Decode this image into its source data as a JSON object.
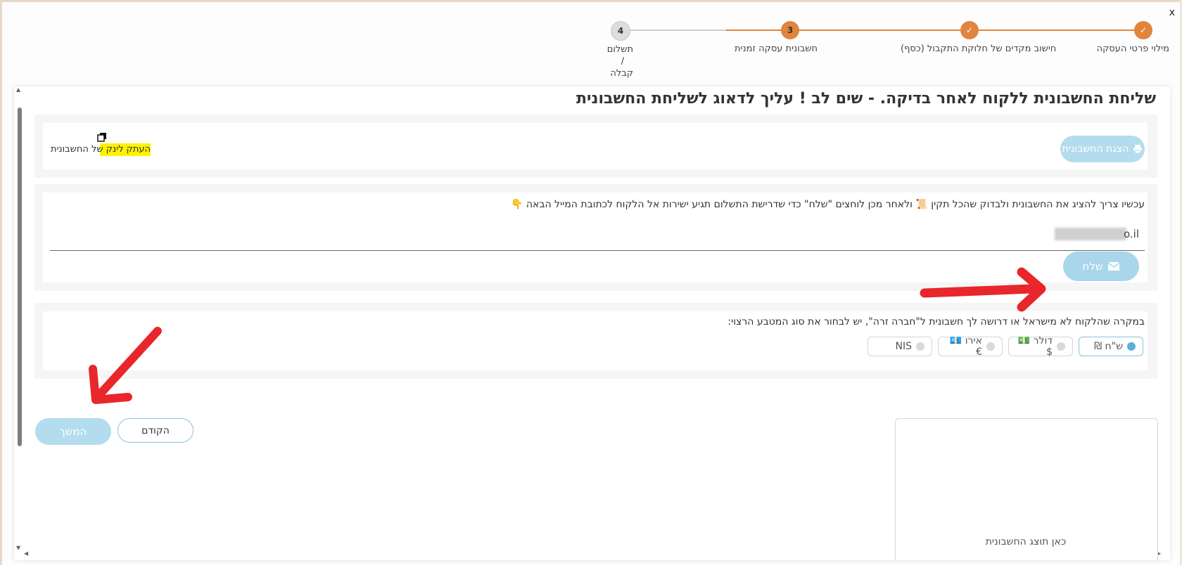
{
  "close_label": "x",
  "stepper": {
    "steps": [
      {
        "label": "מילוי פרטי העסקה",
        "state": "done",
        "number": "✓"
      },
      {
        "label": "חישוב מקדים של חלוקת התקבול (כסף)",
        "state": "done",
        "number": "✓"
      },
      {
        "label": "חשבונית עסקה זמנית",
        "state": "current",
        "number": "3"
      },
      {
        "label": "תשלום / קבלה",
        "state": "pending",
        "number": "4"
      }
    ]
  },
  "main": {
    "title": "שליחת החשבונית ללקוח לאחר בדיקה. - שים לב ! עליך לדאוג לשליחת החשבונית",
    "print_button": "הצגת החשבונית",
    "copy_link_text": "העתק לינק של החשבונית",
    "instruction": "עכשיו צריך להציג את החשבונית ולבדוק שהכל תקין 📜 ולאחר מכן לוחצים \"שלח\" כדי שדרישת התשלום תגיע ישירות אל הלקוח לכתובת המייל הבאה 👇",
    "email_value": "o.il",
    "send_button": "שלח",
    "currency_question": "במקרה שהלקוח לא מישראל או דרושה לך חשבונית ל\"חברה זרה\", יש לבחור את סוג המטבע הרצוי:",
    "currency_options": [
      {
        "label": "ש\"ח ₪",
        "selected": true
      },
      {
        "label": "דולר 💵$",
        "selected": false
      },
      {
        "label": "אירו 💶€",
        "selected": false
      },
      {
        "label": "NIS",
        "selected": false
      }
    ],
    "prev_button": "הקודם",
    "next_button": "המשך",
    "preview_placeholder": "כאן תוצג החשבונית"
  },
  "colors": {
    "accent_orange": "#e1843d",
    "button_blue": "#b3dcee",
    "annotation_red": "#e8262b",
    "highlight_yellow": "#fff200"
  }
}
